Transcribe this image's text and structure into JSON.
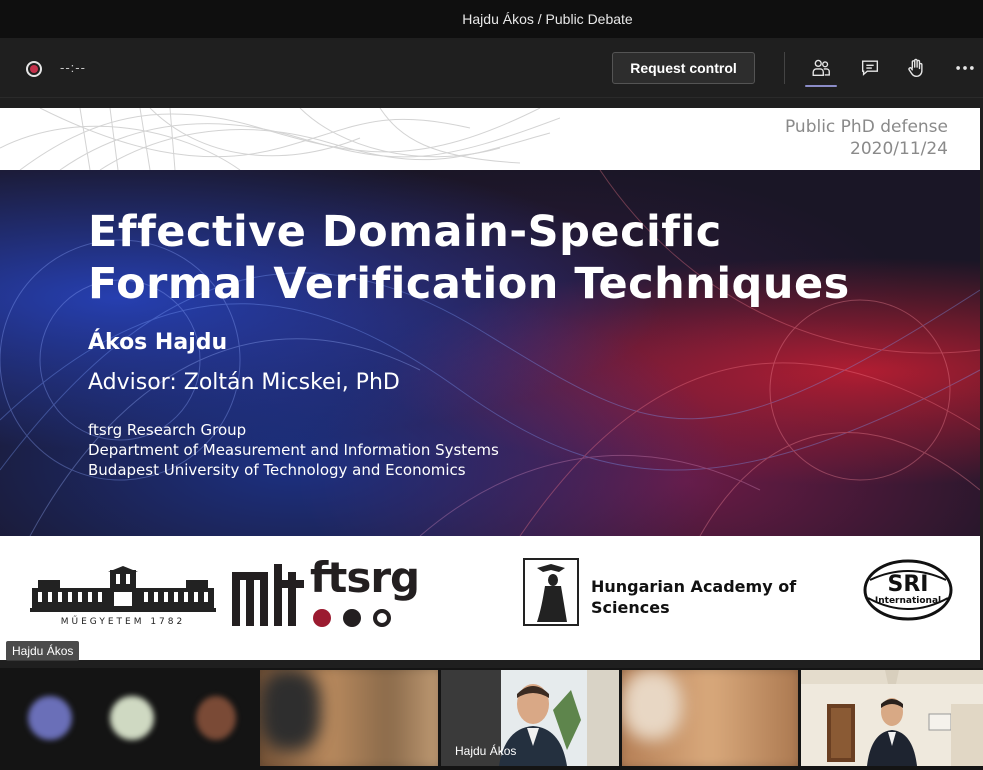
{
  "window": {
    "title": "Hajdu Ákos / Public Debate"
  },
  "toolbar": {
    "record_icon": "record-icon",
    "timer": "--:--",
    "request_control_label": "Request control",
    "icons": [
      "participants-icon",
      "chat-icon",
      "raise-hand-icon",
      "more-options-icon"
    ],
    "accent_color": "#8b8cc7",
    "record_color": "#c4314b"
  },
  "slide": {
    "header": {
      "line1": "Public PhD defense",
      "line2": "2020/11/24"
    },
    "title_line1": "Effective Domain-Specific",
    "title_line2": "Formal Verification Techniques",
    "author": "Ákos Hajdu",
    "advisor": "Advisor: Zoltán Micskei, PhD",
    "affiliation": [
      "ftsrg Research Group",
      "Department of Measurement and Information Systems",
      "Budapest University of Technology and Economics"
    ],
    "logos": {
      "bme_caption": "MŰEGYETEM 1782",
      "mit": "mit",
      "ftsrg": "ftsrg",
      "mta_line1": "Hungarian Academy of",
      "mta_line2": "Sciences",
      "sri_line1": "SRI",
      "sri_line2": "International"
    }
  },
  "presenter_tag": "Hajdu Ákos",
  "participants": {
    "featured_name": "Hajdu Ákos",
    "avatar_colors": [
      "#6a6fb8",
      "#cfd9c2",
      "#7a4a36"
    ],
    "tile_count": 5
  }
}
